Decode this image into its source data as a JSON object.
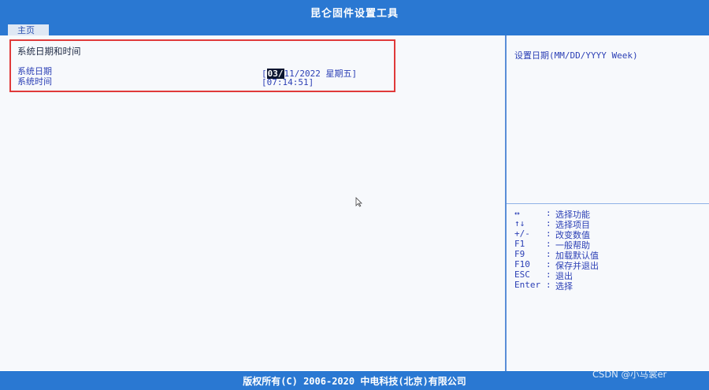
{
  "app": {
    "title": "昆仑固件设置工具"
  },
  "tabs": [
    {
      "label": "主页"
    }
  ],
  "section": {
    "title": "系统日期和时间"
  },
  "rows": [
    {
      "label": "系统日期",
      "value_prefix": "[",
      "value_selected": "03/",
      "value_rest": "11/2022 星期五]"
    },
    {
      "label": "系统时间",
      "value": "[07:14:51]"
    }
  ],
  "help": {
    "text": "设置日期(MM/DD/YYYY Week)"
  },
  "keys": [
    {
      "key": "↔",
      "sep": ":",
      "desc": "选择功能"
    },
    {
      "key": "↑↓",
      "sep": ":",
      "desc": "选择项目"
    },
    {
      "key": "+/-",
      "sep": ":",
      "desc": "改变数值"
    },
    {
      "key": "F1",
      "sep": ":",
      "desc": "一般帮助"
    },
    {
      "key": "F9",
      "sep": ":",
      "desc": "加载默认值"
    },
    {
      "key": "F10",
      "sep": ":",
      "desc": "保存并退出"
    },
    {
      "key": "ESC",
      "sep": ":",
      "desc": "退出"
    },
    {
      "key": "Enter",
      "sep": ":",
      "desc": "选择"
    }
  ],
  "footer": {
    "copyright": "版权所有(C) 2006-2020 中电科技(北京)有限公司"
  },
  "watermark": "CSDN @小马裳er",
  "colors": {
    "bar": "#2a78d2",
    "text": "#2b3fb5",
    "highlight": "#e03a3a"
  }
}
